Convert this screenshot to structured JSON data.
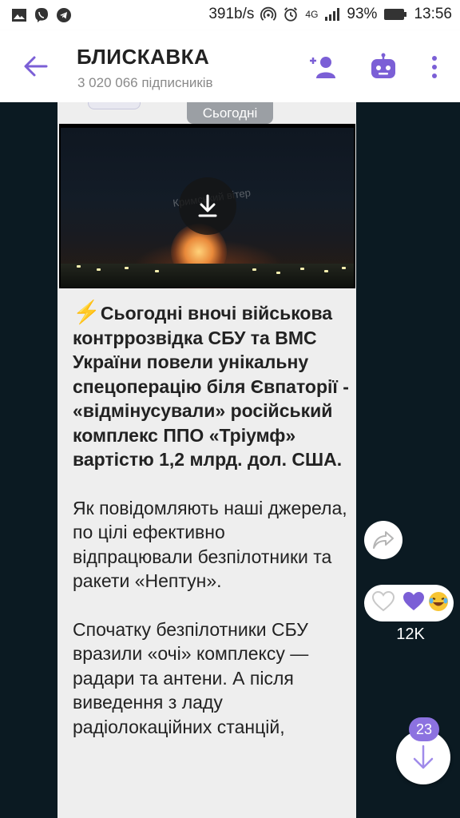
{
  "status_bar": {
    "net_speed": "391b/s",
    "network_type": "4G",
    "battery": "93%",
    "time": "13:56"
  },
  "header": {
    "title": "БЛИСКАВКА",
    "subtitle": "3 020 066 підписників"
  },
  "chat": {
    "date_label": "Сьогодні",
    "video": {
      "watermark": "Кримський вітер"
    },
    "message": {
      "lead_bold": "Сьогодні вночі військова контррозвідка СБУ та ВМС України повели унікальну спецоперацію біля Євпаторії - «відмінусували» російський комплекс ППО «Тріумф» вартістю 1,2 млрд. дол. США.",
      "para2": "Як повідомляють наші джерела, по цілі ефективно відпрацювали безпілотники та ракети «Нептун».",
      "para3": "Спочатку безпілотники СБУ вразили «очі» комплексу —  радари та антени. А після виведення з ладу радіолокаційних станцій,"
    },
    "reactions": {
      "count": "12K"
    },
    "unread_count": "23"
  },
  "colors": {
    "accent": "#7b5fd6",
    "chat_bg": "#0b1a22",
    "bubble": "#eeeeee"
  }
}
